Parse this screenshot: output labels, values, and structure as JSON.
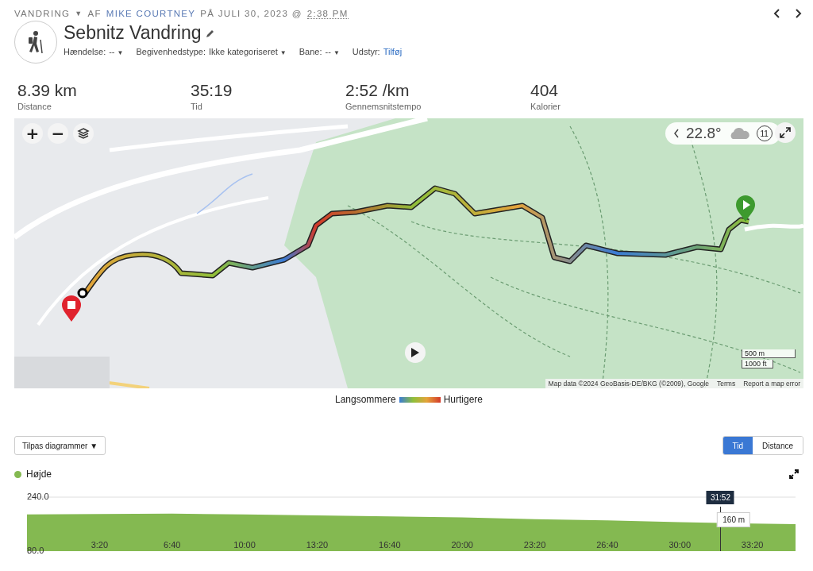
{
  "header": {
    "activity_type": "VANDRING",
    "caret": "▼",
    "byline": "AF",
    "author": "MIKE COURTNEY",
    "date": "PÅ JULI 30, 2023 @",
    "time": "2:38 PM"
  },
  "title": "Sebnitz Vandring",
  "fields": [
    {
      "label": "Hændelse:",
      "value": "--",
      "caret": "▼",
      "kind": "dropdown"
    },
    {
      "label": "Begivenhedstype:",
      "value": "Ikke kategoriseret",
      "caret": "▼",
      "kind": "dropdown"
    },
    {
      "label": "Bane:",
      "value": "--",
      "caret": "▼",
      "kind": "dropdown"
    },
    {
      "label": "Udstyr:",
      "value": "Tilføj",
      "kind": "link"
    }
  ],
  "stats": [
    {
      "value": "8.39 km",
      "label": "Distance"
    },
    {
      "value": "35:19",
      "label": "Tid"
    },
    {
      "value": "2:52 /km",
      "label": "Gennemsnitstempo"
    },
    {
      "value": "404",
      "label": "Kalorier"
    }
  ],
  "map": {
    "kind": "picture",
    "zoom_in": "+",
    "zoom_out": "−",
    "temperature": "22.8°",
    "wind": "11",
    "scale": [
      "500 m",
      "1000 ft"
    ],
    "attribution": [
      "Map data ©2024 GeoBasis-DE/BKG (©2009), Google",
      "Terms",
      "Report a map error"
    ]
  },
  "speed_legend": {
    "slower": "Langsommere",
    "faster": "Hurtigere"
  },
  "customize": {
    "label": "Tilpas diagrammer",
    "caret": "▼"
  },
  "axis_toggle": [
    {
      "label": "Tid",
      "selected": true
    },
    {
      "label": "Distance",
      "selected": false
    }
  ],
  "elevation": {
    "tooltip": {
      "time": "31:52",
      "value": "160 m"
    },
    "chart_data": {
      "type": "area",
      "series": [
        {
          "name": "Højde",
          "color": "#84b951",
          "values": [
            189,
            190,
            191,
            189,
            186,
            183,
            180,
            175,
            171,
            166,
            162,
            160
          ]
        }
      ],
      "x": [
        0,
        200,
        400,
        600,
        800,
        1000,
        1200,
        1400,
        1600,
        1800,
        2000,
        2119
      ],
      "xlim": [
        0,
        2119
      ],
      "ylim": [
        80,
        240
      ],
      "yticks": [
        {
          "value": 80,
          "label": "80.0"
        },
        {
          "value": 240,
          "label": "240.0"
        }
      ],
      "xticks": [
        {
          "value": 200,
          "label": "3:20"
        },
        {
          "value": 400,
          "label": "6:40"
        },
        {
          "value": 600,
          "label": "10:00"
        },
        {
          "value": 800,
          "label": "13:20"
        },
        {
          "value": 1000,
          "label": "16:40"
        },
        {
          "value": 1200,
          "label": "20:00"
        },
        {
          "value": 1400,
          "label": "23:20"
        },
        {
          "value": 1600,
          "label": "26:40"
        },
        {
          "value": 1800,
          "label": "30:00"
        },
        {
          "value": 2000,
          "label": "33:20"
        }
      ]
    }
  }
}
